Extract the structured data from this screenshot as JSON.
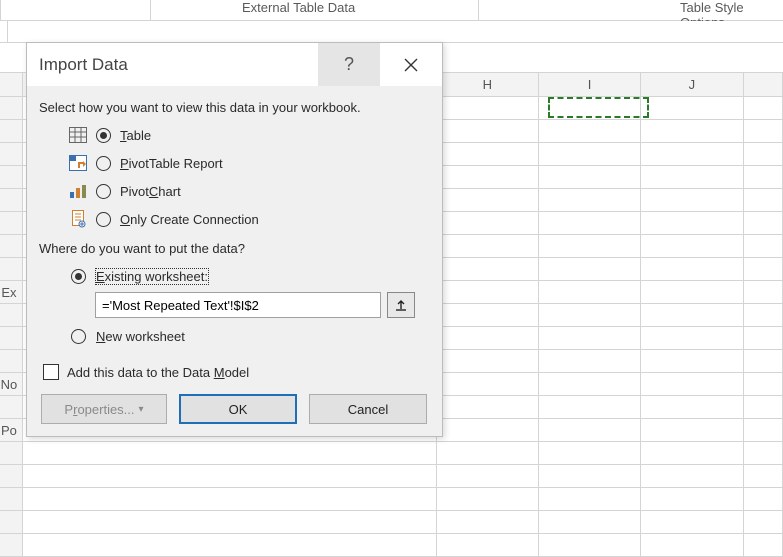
{
  "ribbon": {
    "group_left": "External Table Data",
    "group_right": "Table Style Options"
  },
  "columns": {
    "h": "H",
    "i": "I",
    "j": "J"
  },
  "rowLabels": {
    "ex": "Ex",
    "no": "No",
    "po": "Po"
  },
  "dialog": {
    "title": "Import Data",
    "help": "?",
    "section_view": "Select how you want to view this data in your workbook.",
    "opt_table": "Table",
    "opt_pivottable": "PivotTable Report",
    "opt_pivotchart": "PivotChart",
    "opt_onlyconn": "Only Create Connection",
    "section_where": "Where do you want to put the data?",
    "opt_existing": "Existing worksheet:",
    "ref_value": "='Most Repeated Text'!$I$2",
    "opt_newsheet": "New worksheet",
    "chk_datamodel": "Add this data to the Data Model",
    "btn_properties": "Properties...",
    "btn_ok": "OK",
    "btn_cancel": "Cancel"
  }
}
